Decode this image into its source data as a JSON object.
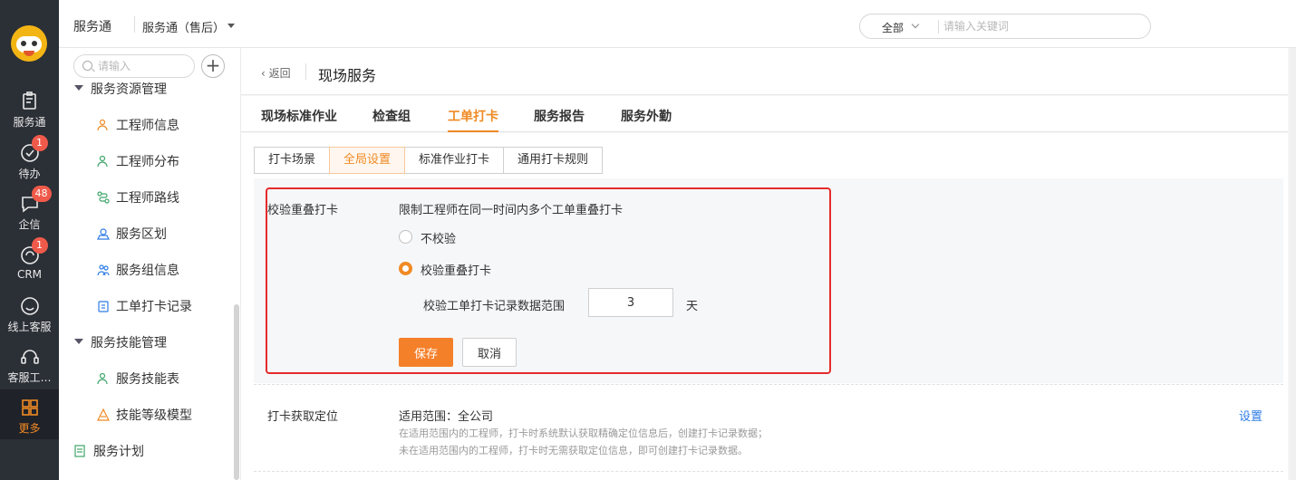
{
  "rail": {
    "items": [
      {
        "label": "服务通",
        "icon": "clipboard-icon"
      },
      {
        "label": "待办",
        "icon": "check-circle-icon",
        "badge": "1"
      },
      {
        "label": "企信",
        "icon": "chat-bubble-icon",
        "badge": "48"
      },
      {
        "label": "CRM",
        "icon": "crm-icon",
        "badge": "1"
      },
      {
        "label": "线上客服",
        "icon": "smile-icon"
      },
      {
        "label": "客服工…",
        "icon": "headset-icon"
      },
      {
        "label": "更多",
        "icon": "grid-icon"
      }
    ]
  },
  "header": {
    "app_title": "服务通",
    "app_sub": "服务通（售后）",
    "search_scope": "全部",
    "search_placeholder": "请输入关键词"
  },
  "subnav": {
    "search_placeholder": "请输入",
    "add": "+",
    "group1": "服务资源管理",
    "group1_items": [
      "工程师信息",
      "工程师分布",
      "工程师路线",
      "服务区划",
      "服务组信息",
      "工单打卡记录"
    ],
    "group2": "服务技能管理",
    "group2_items": [
      "服务技能表",
      "技能等级模型"
    ],
    "leaf": "服务计划"
  },
  "page": {
    "back": "返回",
    "title": "现场服务",
    "tabs": [
      "现场标准作业",
      "检查组",
      "工单打卡",
      "服务报告",
      "服务外勤"
    ],
    "active_tab": "工单打卡",
    "seg": [
      "打卡场景",
      "全局设置",
      "标准作业打卡",
      "通用打卡规则"
    ],
    "active_seg": "全局设置"
  },
  "overlap": {
    "label": "校验重叠打卡",
    "desc": "限制工程师在同一时间内多个工单重叠打卡",
    "opt_no": "不校验",
    "opt_yes": "校验重叠打卡",
    "range_label": "校验工单打卡记录数据范围",
    "range_value": "3",
    "range_unit": "天",
    "save": "保存",
    "cancel": "取消"
  },
  "location": {
    "label": "打卡获取定位",
    "scope": "适用范围：全公司",
    "hint1": "在适用范围内的工程师，打卡时系统默认获取精确定位信息后，创建打卡记录数据；",
    "hint2": "未在适用范围内的工程师，打卡时无需获取定位信息，即可创建打卡记录数据。",
    "setting": "设置"
  },
  "colors": {
    "accent": "#f08a24",
    "primary_button": "#f5802a",
    "rail_bg": "#2b2f36",
    "highlight_box": "#e52b2b",
    "link": "#2d7be5"
  }
}
